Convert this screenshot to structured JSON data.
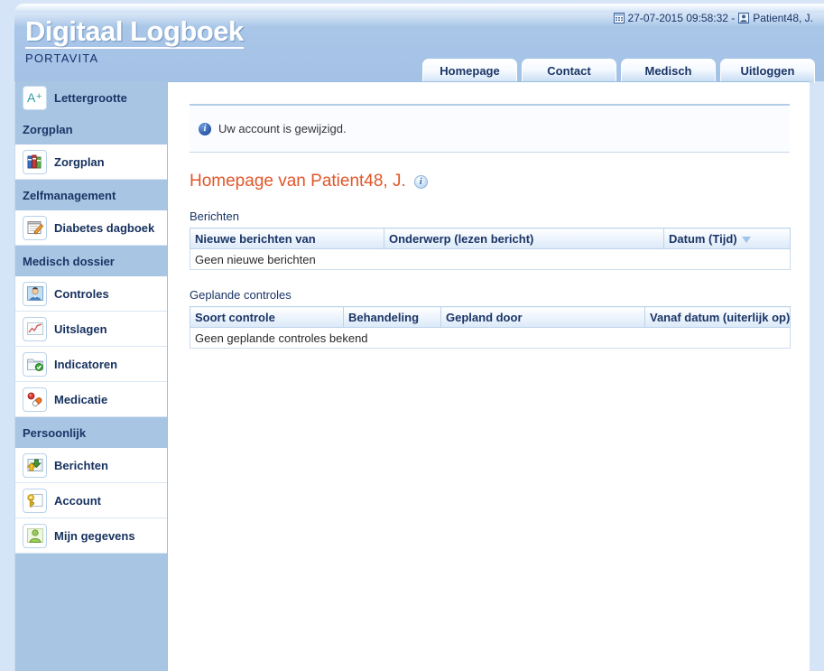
{
  "app": {
    "logo_title": "Digitaal Logboek",
    "logo_subtitle": "PORTAVITA"
  },
  "statusbar": {
    "calendar_icon": "calendar-icon",
    "datetime": "27-07-2015 09:58:32 -",
    "user_icon": "user-icon",
    "user": "Patient48, J."
  },
  "tabs": [
    {
      "label": "Homepage",
      "active": true
    },
    {
      "label": "Contact",
      "active": false
    },
    {
      "label": "Medisch",
      "active": false
    },
    {
      "label": "Uitloggen",
      "active": false
    }
  ],
  "sidebar": {
    "fontsize_tool": {
      "label": "Lettergrootte",
      "icon": "a-plus-icon"
    },
    "groups": [
      {
        "header": "Zorgplan",
        "items": [
          {
            "label": "Zorgplan",
            "icon": "books-icon"
          }
        ]
      },
      {
        "header": "Zelfmanagement",
        "items": [
          {
            "label": "Diabetes dagboek",
            "icon": "notepad-pen-icon"
          }
        ]
      },
      {
        "header": "Medisch dossier",
        "items": [
          {
            "label": "Controles",
            "icon": "doctor-icon"
          },
          {
            "label": "Uitslagen",
            "icon": "line-chart-icon"
          },
          {
            "label": "Indicatoren",
            "icon": "folder-check-icon"
          },
          {
            "label": "Medicatie",
            "icon": "pills-icon"
          }
        ]
      },
      {
        "header": "Persoonlijk",
        "items": [
          {
            "label": "Berichten",
            "icon": "inbox-arrow-icon"
          },
          {
            "label": "Account",
            "icon": "key-icon"
          },
          {
            "label": "Mijn gegevens",
            "icon": "person-icon"
          }
        ]
      }
    ]
  },
  "main": {
    "notification": {
      "icon": "info-icon",
      "text": "Uw account is gewijzigd."
    },
    "page_title": "Homepage van Patient48, J.",
    "page_title_help_icon": "info-help-icon",
    "sections": [
      {
        "caption": "Berichten",
        "columns": [
          "Nieuwe berichten van",
          "Onderwerp (lezen bericht)",
          "Datum (Tijd)"
        ],
        "sorted_column_index": 2,
        "empty_text": "Geen nieuwe berichten"
      },
      {
        "caption": "Geplande controles",
        "columns": [
          "Soort controle",
          "Behandeling",
          "Gepland door",
          "Vanaf datum (uiterlijk op)"
        ],
        "sorted_column_index": -1,
        "empty_text": "Geen geplande controles bekend"
      }
    ]
  },
  "colors": {
    "sidebar_blue": "#a8c5e3",
    "header_blue": "#a4c2e6",
    "title_orange": "#e2562a",
    "page_bg": "#d6e4f7",
    "nav_text": "#1b3566"
  }
}
